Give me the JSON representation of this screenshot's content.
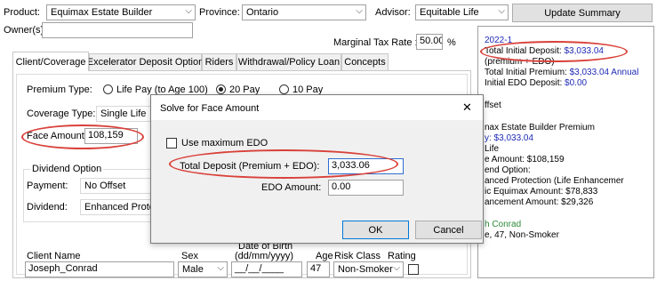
{
  "top": {
    "product_label": "Product:",
    "product_value": "Equimax Estate Builder",
    "province_label": "Province:",
    "province_value": "Ontario",
    "advisor_label": "Advisor:",
    "advisor_value": "Equitable Life",
    "update_summary": "Update Summary",
    "owner_label": "Owner(s):",
    "owner_value": "",
    "marginal_tax_label": "Marginal Tax Rate :",
    "marginal_tax_value": "50.00",
    "percent": "%"
  },
  "tabs": [
    {
      "label": "Client/Coverage"
    },
    {
      "label": "Excelerator Deposit Option"
    },
    {
      "label": "Riders"
    },
    {
      "label": "Withdrawal/Policy Loan"
    },
    {
      "label": "Concepts"
    }
  ],
  "coverage": {
    "premium_type_label": "Premium Type:",
    "premium_options": [
      "Life Pay (to Age 100)",
      "20 Pay",
      "10 Pay"
    ],
    "coverage_type_label": "Coverage Type:",
    "coverage_type_value": "Single Life",
    "face_amount_label": "Face Amount: $",
    "face_amount_value": "108,159",
    "dividend_option_label": "Dividend Option",
    "payment_label": "Payment:",
    "payment_value": "No Offset",
    "dividend_label": "Dividend:",
    "dividend_value": "Enhanced Prote"
  },
  "client": {
    "name_header": "Client Name",
    "sex_header": "Sex",
    "dob_header_1": "Date of Birth",
    "dob_header_2": "(dd/mm/yyyy)",
    "age_header": "Age",
    "risk_header": "Risk Class",
    "rating_header": "Rating",
    "name_value": "Joseph_Conrad",
    "sex_value": "Male",
    "dob_value": "__/__/____",
    "age_value": "47",
    "risk_value": "Non-Smoker"
  },
  "dialog": {
    "title": "Solve for Face Amount",
    "close": "✕",
    "use_max_edo": "Use maximum EDO",
    "total_deposit_label": "Total Deposit (Premium + EDO):",
    "total_deposit_value": "3,033.06",
    "edo_amount_label": "EDO Amount:",
    "edo_amount_value": "0.00",
    "ok": "OK",
    "cancel": "Cancel"
  },
  "summary": {
    "year": "2022-1",
    "l1_prefix": "Total Initial Deposit: ",
    "l1_value": "$3,033.04",
    "l2": "(premium + EDO)",
    "l3_prefix": "Total Initial Premium: ",
    "l3_value": "$3,033.04 Annual",
    "l4_prefix": "Initial EDO Deposit:   ",
    "l4_value": "$0.00",
    "l5": "ffset",
    "l6": "nax Estate Builder Premium",
    "l7": "y: $3,033.04",
    "l8": "Life",
    "l9": "e Amount: $108,159",
    "l10": "end Option:",
    "l11": "anced Protection (Life Enhancemer",
    "l12": "ic Equimax Amount: $78,833",
    "l13": "ancement Amount: $29,326",
    "l14": "h Conrad",
    "l15": "e, 47, Non-Smoker"
  },
  "colors": {
    "highlight": "#d9413a",
    "link_blue": "#1f2bb5"
  }
}
